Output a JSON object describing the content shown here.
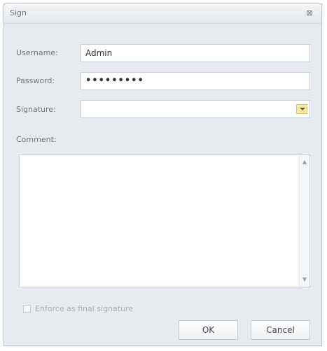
{
  "window": {
    "title": "Sign"
  },
  "form": {
    "username_label": "Username:",
    "username_value": "Admin",
    "password_label": "Password:",
    "password_value": "•••••••••",
    "signature_label": "Signature:",
    "signature_value": "",
    "comment_label": "Comment:",
    "comment_value": ""
  },
  "options": {
    "enforce_final_label": "Enforce as final signature"
  },
  "buttons": {
    "ok_label": "OK",
    "cancel_label": "Cancel"
  },
  "icons": {
    "close": "close-icon",
    "dropdown": "chevron-down-icon",
    "scroll_up": "arrow-up-icon",
    "scroll_down": "arrow-down-icon"
  },
  "colors": {
    "window_background": "#e6eaef",
    "field_background": "#ffffff",
    "dropdown_accent": "#f7e7a6",
    "text_secondary": "#70787f"
  }
}
